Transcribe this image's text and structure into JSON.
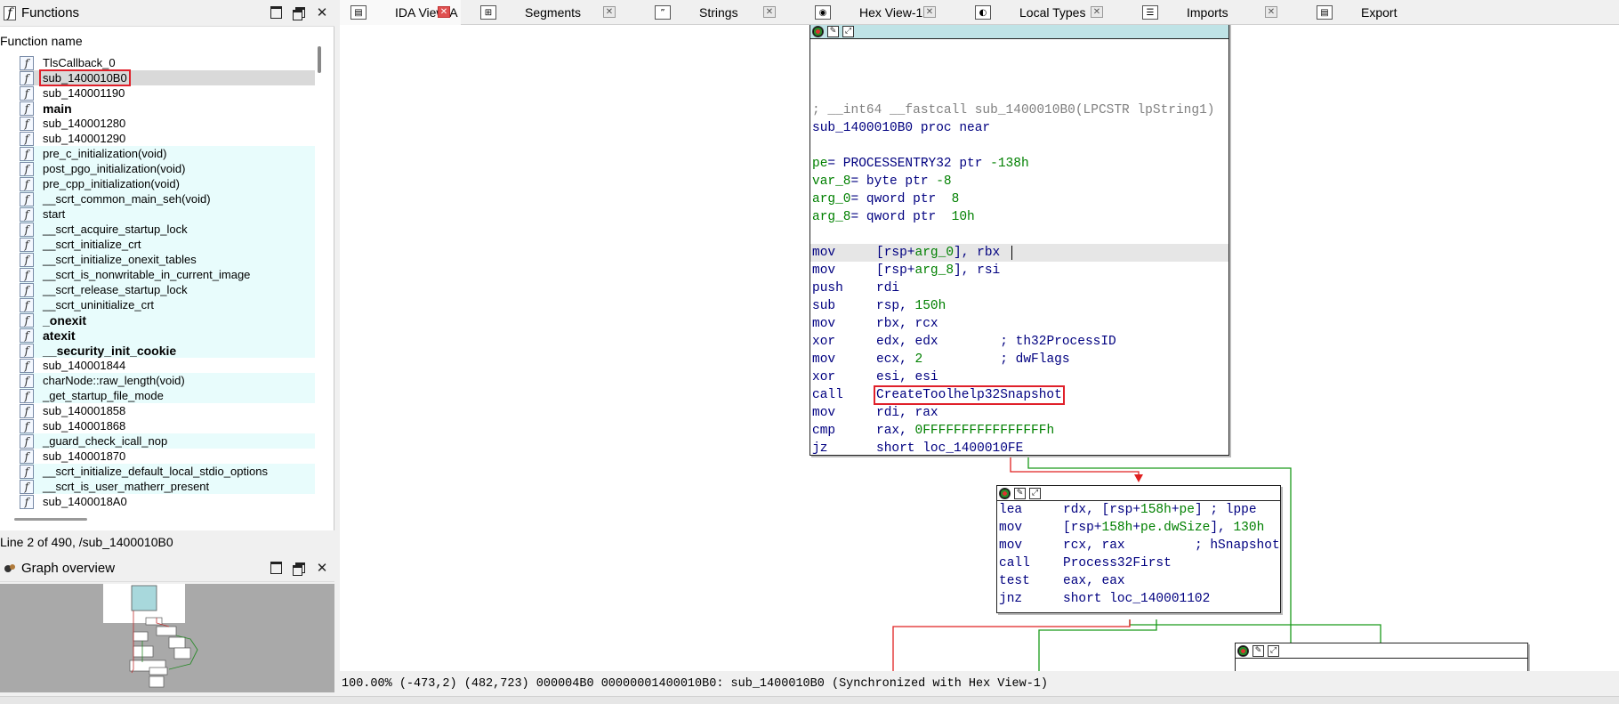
{
  "functions_panel": {
    "title": "Functions",
    "icon": "function-icon",
    "column_header": "Function name",
    "items": [
      {
        "name": "TlsCallback_0",
        "style": "normal"
      },
      {
        "name": "sub_1400010B0",
        "style": "selected"
      },
      {
        "name": "sub_140001190",
        "style": "normal"
      },
      {
        "name": "main",
        "style": "bold"
      },
      {
        "name": "sub_140001280",
        "style": "normal"
      },
      {
        "name": "sub_140001290",
        "style": "normal"
      },
      {
        "name": "pre_c_initialization(void)",
        "style": "lib"
      },
      {
        "name": "post_pgo_initialization(void)",
        "style": "lib"
      },
      {
        "name": "pre_cpp_initialization(void)",
        "style": "lib"
      },
      {
        "name": "__scrt_common_main_seh(void)",
        "style": "lib"
      },
      {
        "name": "start",
        "style": "lib"
      },
      {
        "name": "__scrt_acquire_startup_lock",
        "style": "lib"
      },
      {
        "name": "__scrt_initialize_crt",
        "style": "lib"
      },
      {
        "name": "__scrt_initialize_onexit_tables",
        "style": "lib"
      },
      {
        "name": "__scrt_is_nonwritable_in_current_image",
        "style": "lib"
      },
      {
        "name": "__scrt_release_startup_lock",
        "style": "lib"
      },
      {
        "name": "__scrt_uninitialize_crt",
        "style": "lib"
      },
      {
        "name": "_onexit",
        "style": "libbold"
      },
      {
        "name": "atexit",
        "style": "libbold"
      },
      {
        "name": "__security_init_cookie",
        "style": "libbold"
      },
      {
        "name": "sub_140001844",
        "style": "normal"
      },
      {
        "name": "charNode::raw_length(void)",
        "style": "lib"
      },
      {
        "name": "_get_startup_file_mode",
        "style": "lib"
      },
      {
        "name": "sub_140001858",
        "style": "normal"
      },
      {
        "name": "sub_140001868",
        "style": "normal"
      },
      {
        "name": "_guard_check_icall_nop",
        "style": "lib"
      },
      {
        "name": "sub_140001870",
        "style": "normal"
      },
      {
        "name": "__scrt_initialize_default_local_stdio_options",
        "style": "lib"
      },
      {
        "name": "__scrt_is_user_matherr_present",
        "style": "lib"
      },
      {
        "name": "sub_1400018A0",
        "style": "normal"
      }
    ],
    "status_line": "Line 2 of 490, /sub_1400010B0"
  },
  "graph_overview": {
    "title": "Graph overview"
  },
  "tabs": [
    {
      "label": "IDA View-A",
      "icon": "ida-view-icon",
      "active": true
    },
    {
      "label": "Segments",
      "icon": "segments-icon",
      "active": false
    },
    {
      "label": "Strings",
      "icon": "strings-icon",
      "active": false
    },
    {
      "label": "Hex View-1",
      "icon": "hex-view-icon",
      "active": false
    },
    {
      "label": "Local Types",
      "icon": "local-types-icon",
      "active": false
    },
    {
      "label": "Imports",
      "icon": "imports-icon",
      "active": false
    },
    {
      "label": "Export",
      "icon": "exports-icon",
      "active": false
    }
  ],
  "graph": {
    "node1": {
      "proto": "; __int64 __fastcall sub_1400010B0(LPCSTR lpString1)",
      "proc_line": "sub_1400010B0 proc near",
      "vars": [
        {
          "name": "pe",
          "rest": "= PROCESSENTRY32 ptr ",
          "num": "-138h"
        },
        {
          "name": "var_8",
          "rest": "= byte ptr ",
          "num": "-8"
        },
        {
          "name": "arg_0",
          "rest": "= qword ptr  ",
          "num": "8"
        },
        {
          "name": "arg_8",
          "rest": "= qword ptr  ",
          "num": "10h"
        }
      ],
      "code": [
        {
          "mn": "mov",
          "op": "[rsp+",
          "op_var": "arg_0",
          "op_tail": "], rbx",
          "cmt": "",
          "num": ""
        },
        {
          "mn": "mov",
          "op": "[rsp+",
          "op_var": "arg_8",
          "op_tail": "], rsi",
          "cmt": "",
          "num": ""
        },
        {
          "mn": "push",
          "op": "rdi",
          "op_var": "",
          "op_tail": "",
          "cmt": "",
          "num": ""
        },
        {
          "mn": "sub",
          "op": "rsp, ",
          "op_var": "",
          "op_tail": "",
          "cmt": "",
          "num": "150h"
        },
        {
          "mn": "mov",
          "op": "rbx, rcx",
          "op_var": "",
          "op_tail": "",
          "cmt": "",
          "num": ""
        },
        {
          "mn": "xor",
          "op": "edx, edx        ",
          "op_var": "",
          "op_tail": "",
          "cmt": "; th32ProcessID",
          "num": ""
        },
        {
          "mn": "mov",
          "op": "ecx, ",
          "op_var": "",
          "op_tail": "          ",
          "cmt": "; dwFlags",
          "num": "2"
        },
        {
          "mn": "xor",
          "op": "esi, esi",
          "op_var": "",
          "op_tail": "",
          "cmt": "",
          "num": ""
        },
        {
          "mn": "call",
          "op": "CreateToolhelp32Snapshot",
          "op_var": "",
          "op_tail": "",
          "cmt": "",
          "num": ""
        },
        {
          "mn": "mov",
          "op": "rdi, rax",
          "op_var": "",
          "op_tail": "",
          "cmt": "",
          "num": ""
        },
        {
          "mn": "cmp",
          "op": "rax, ",
          "op_var": "",
          "op_tail": "",
          "cmt": "",
          "num": "0FFFFFFFFFFFFFFFFh"
        },
        {
          "mn": "jz",
          "op": "short loc_1400010FE",
          "op_var": "",
          "op_tail": "",
          "cmt": "",
          "num": ""
        }
      ]
    },
    "node2": {
      "code": [
        {
          "mn": "lea",
          "pre": "rdx, [rsp+",
          "num": "158h",
          "mid": "+",
          "var": "pe",
          "tail": "] ; lppe"
        },
        {
          "mn": "mov",
          "pre": "[rsp+",
          "num": "158h",
          "mid": "+",
          "var": "pe.dwSize",
          "tail": "], ",
          "num2": "130h"
        },
        {
          "mn": "mov",
          "pre": "rcx, rax         ",
          "num": "",
          "mid": "",
          "var": "",
          "tail": "; hSnapshot"
        },
        {
          "mn": "call",
          "pre": "Process32First",
          "num": "",
          "mid": "",
          "var": "",
          "tail": ""
        },
        {
          "mn": "test",
          "pre": "eax, eax",
          "num": "",
          "mid": "",
          "var": "",
          "tail": ""
        },
        {
          "mn": "jnz",
          "pre": "short loc_140001102",
          "num": "",
          "mid": "",
          "var": "",
          "tail": ""
        }
      ]
    }
  },
  "graph_status": {
    "zoom": "100.00%",
    "coord1": "(-473,2)",
    "coord2": "(482,723)",
    "offset": "000004B0",
    "address": "00000001400010B0: sub_1400010B0",
    "sync": "(Synchronized with Hex View-1)"
  },
  "colors": {
    "edge_false": "#e02020",
    "edge_true": "#1a9a1a",
    "lib_bg": "#e8fcfc",
    "highlight_box": "#e0202a"
  }
}
